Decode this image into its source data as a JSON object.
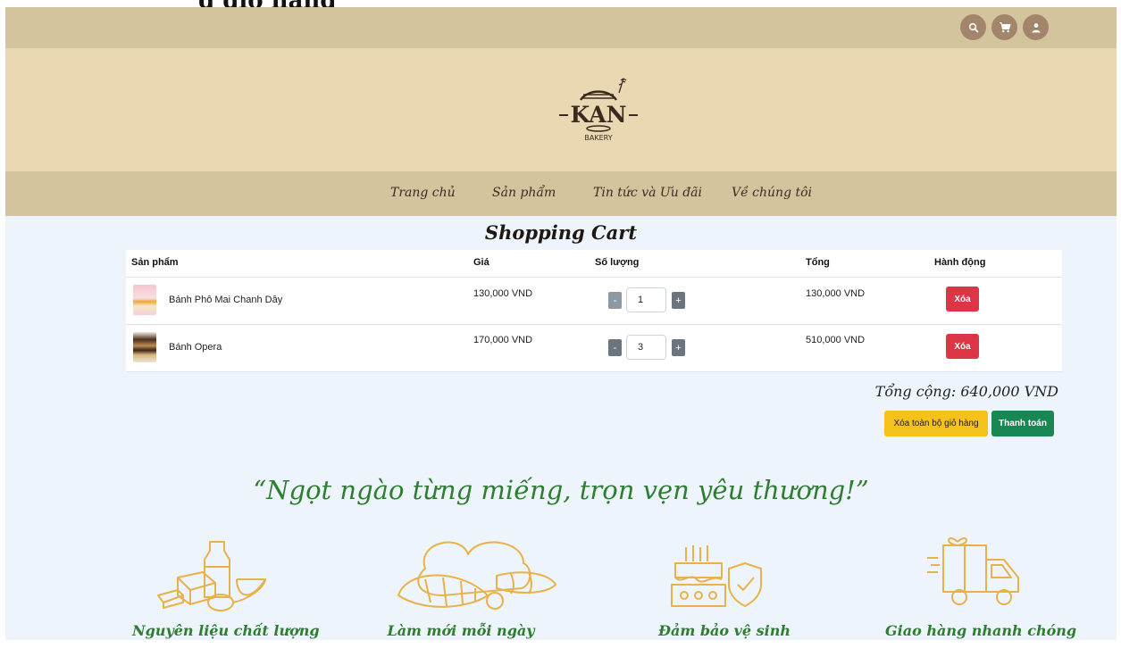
{
  "page_title_cut": "g giỏ hàng",
  "colors": {
    "topbar": "#d4c49e",
    "logo_band": "#ead8b3",
    "content_bg": "#edf4fb",
    "accent_green": "#2e7d32",
    "danger": "#dc3545",
    "warning": "#f5c21b",
    "success": "#198754",
    "icon_gold": "#e8b14a"
  },
  "header": {
    "icons": [
      "search-icon",
      "cart-icon",
      "user-icon"
    ],
    "logo": {
      "main": "KAN",
      "sub": "BAKERY"
    }
  },
  "nav": {
    "items": [
      {
        "label": "Trang chủ"
      },
      {
        "label": "Sản phẩm"
      },
      {
        "label": "Tin tức và Ưu đãi"
      },
      {
        "label": "Về chúng tôi"
      }
    ]
  },
  "cart": {
    "title": "Shopping Cart",
    "columns": {
      "product": "Sản phẩm",
      "price": "Giá",
      "quantity": "Số lượng",
      "total": "Tổng",
      "action": "Hành động"
    },
    "items": [
      {
        "name": "Bánh Phô Mai Chanh Dây",
        "price": "130,000 VND",
        "quantity": "1",
        "total": "130,000 VND",
        "delete_label": "Xóa"
      },
      {
        "name": "Bánh Opera",
        "price": "170,000 VND",
        "quantity": "3",
        "total": "510,000 VND",
        "delete_label": "Xóa"
      }
    ],
    "minus_label": "-",
    "plus_label": "+",
    "grand_total": "Tổng cộng: 640,000 VND",
    "clear_label": "Xóa toàn bộ giỏ hàng",
    "checkout_label": "Thanh toán"
  },
  "slogan": "“Ngọt ngào từng miếng, trọn vẹn yêu thương!”",
  "features": [
    {
      "icon": "ingredients-icon",
      "label": "Nguyên liệu chất lượng"
    },
    {
      "icon": "bread-icon",
      "label": "Làm mới mỗi ngày"
    },
    {
      "icon": "hygiene-cake-icon",
      "label": "Đảm bảo vệ sinh"
    },
    {
      "icon": "delivery-truck-icon",
      "label": "Giao hàng nhanh chóng"
    }
  ]
}
